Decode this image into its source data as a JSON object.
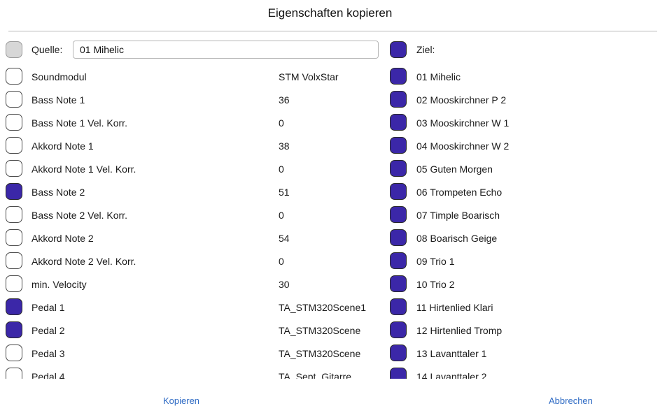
{
  "dialog": {
    "title": "Eigenschaften kopieren"
  },
  "source": {
    "label": "Quelle:",
    "value": "01 Mihelic",
    "checked": false
  },
  "target": {
    "label": "Ziel:",
    "checked": true
  },
  "properties": [
    {
      "label": "Soundmodul",
      "value": "STM VolxStar",
      "checked": false
    },
    {
      "label": "Bass Note 1",
      "value": "36",
      "checked": false
    },
    {
      "label": "Bass Note 1 Vel. Korr.",
      "value": "0",
      "checked": false
    },
    {
      "label": "Akkord Note 1",
      "value": "38",
      "checked": false
    },
    {
      "label": "Akkord Note 1 Vel. Korr.",
      "value": "0",
      "checked": false
    },
    {
      "label": "Bass Note 2",
      "value": "51",
      "checked": true
    },
    {
      "label": "Bass Note 2 Vel. Korr.",
      "value": "0",
      "checked": false
    },
    {
      "label": "Akkord Note 2",
      "value": "54",
      "checked": false
    },
    {
      "label": "Akkord Note 2 Vel. Korr.",
      "value": "0",
      "checked": false
    },
    {
      "label": "min. Velocity",
      "value": "30",
      "checked": false
    },
    {
      "label": "Pedal 1",
      "value": "TA_STM320Scene1",
      "checked": true
    },
    {
      "label": "Pedal 2",
      "value": "TA_STM320Scene",
      "checked": true
    },
    {
      "label": "Pedal 3",
      "value": "TA_STM320Scene",
      "checked": false
    },
    {
      "label": "Pedal 4",
      "value": "TA_Sept_Gitarre",
      "checked": false
    }
  ],
  "targets": [
    {
      "label": "01 Mihelic",
      "checked": true
    },
    {
      "label": "02 Mooskirchner P 2",
      "checked": true
    },
    {
      "label": "03 Mooskirchner W 1",
      "checked": true
    },
    {
      "label": "04 Mooskirchner W 2",
      "checked": true
    },
    {
      "label": "05 Guten Morgen",
      "checked": true
    },
    {
      "label": "06 Trompeten Echo",
      "checked": true
    },
    {
      "label": "07 Timple Boarisch",
      "checked": true
    },
    {
      "label": "08 Boarisch Geige",
      "checked": true
    },
    {
      "label": "09 Trio 1",
      "checked": true
    },
    {
      "label": "10 Trio 2",
      "checked": true
    },
    {
      "label": "11 Hirtenlied Klari",
      "checked": true
    },
    {
      "label": "12 Hirtenlied Tromp",
      "checked": true
    },
    {
      "label": "13 Lavanttaler 1",
      "checked": true
    },
    {
      "label": "14 Lavanttaler 2",
      "checked": true
    }
  ],
  "buttons": {
    "copy": "Kopieren",
    "cancel": "Abbrechen"
  },
  "colors": {
    "checked": "#3b27a8",
    "link": "#2f6bc4",
    "source_checkbox": "#d7d7d7"
  }
}
